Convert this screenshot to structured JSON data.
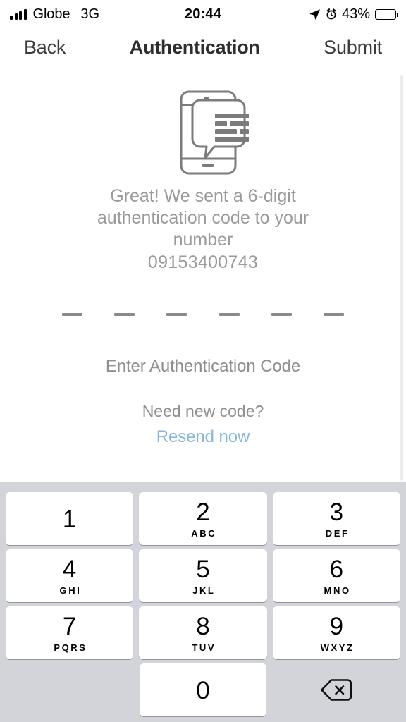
{
  "statusbar": {
    "carrier": "Globe",
    "network": "3G",
    "time": "20:44",
    "battery_percent": "43%",
    "icons": {
      "signal": "signal-bars-icon",
      "location": "location-arrow-icon",
      "alarm": "alarm-clock-icon",
      "battery": "battery-icon"
    }
  },
  "navbar": {
    "back_label": "Back",
    "title": "Authentication",
    "submit_label": "Submit"
  },
  "main": {
    "illustration_name": "phone-with-message-bubble-icon",
    "message": "Great! We sent a 6-digit authentication code to your number",
    "phone_number": "09153400743",
    "otp": {
      "length": 6,
      "values": [
        "",
        "",
        "",
        "",
        "",
        ""
      ]
    },
    "enter_code_label": "Enter Authentication Code",
    "need_new_code_label": "Need new code?",
    "resend_label": "Resend now",
    "resend_color": "#88b8d6"
  },
  "keypad": {
    "background_color": "#d2d4d9",
    "key_color": "#ffffff",
    "rows": [
      [
        {
          "digit": "1",
          "letters": ""
        },
        {
          "digit": "2",
          "letters": "ABC"
        },
        {
          "digit": "3",
          "letters": "DEF"
        }
      ],
      [
        {
          "digit": "4",
          "letters": "GHI"
        },
        {
          "digit": "5",
          "letters": "JKL"
        },
        {
          "digit": "6",
          "letters": "MNO"
        }
      ],
      [
        {
          "digit": "7",
          "letters": "PQRS"
        },
        {
          "digit": "8",
          "letters": "TUV"
        },
        {
          "digit": "9",
          "letters": "WXYZ"
        }
      ]
    ],
    "zero_key": {
      "digit": "0",
      "letters": ""
    },
    "delete_icon": "backspace-delete-icon"
  }
}
